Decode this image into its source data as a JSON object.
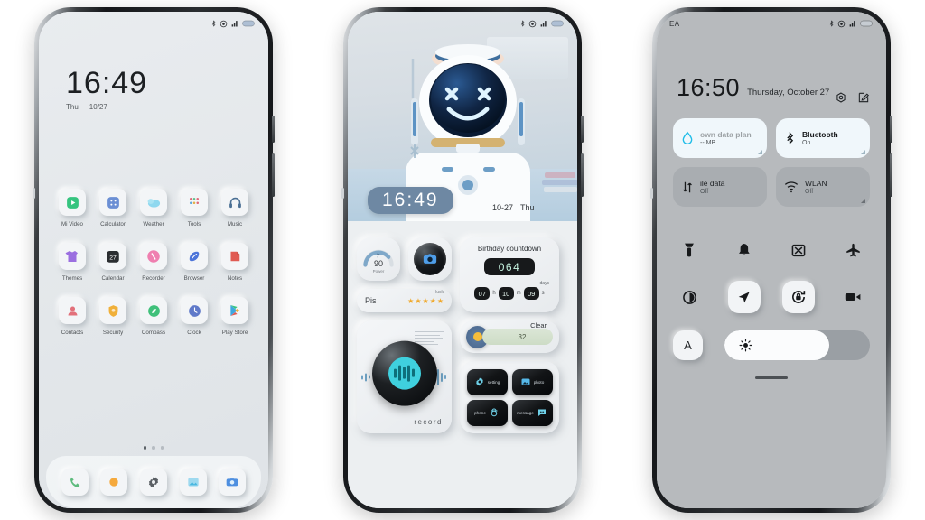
{
  "phone1": {
    "status": {
      "left": "",
      "icons": [
        "bluetooth-icon",
        "dnd-icon",
        "signal-icon",
        "battery-icon"
      ]
    },
    "clock": {
      "time": "16:49",
      "weekday": "Thu",
      "date": "10/27"
    },
    "apps": [
      [
        {
          "label": "Mi Video",
          "icon": "mi-video-icon",
          "color": "#35c47f"
        },
        {
          "label": "Calculator",
          "icon": "calculator-icon",
          "color": "#6b8fd4"
        },
        {
          "label": "Weather",
          "icon": "weather-icon",
          "color": "#4fc3e8"
        },
        {
          "label": "Tools",
          "icon": "tools-icon",
          "color": "#e06a7a"
        },
        {
          "label": "Music",
          "icon": "music-icon",
          "color": "#4a6f94"
        }
      ],
      [
        {
          "label": "Themes",
          "icon": "themes-icon",
          "color": "#9b6fe0"
        },
        {
          "label": "Calendar",
          "icon": "calendar-icon",
          "color": "#2b2e31"
        },
        {
          "label": "Recorder",
          "icon": "recorder-icon",
          "color": "#ef7fb0"
        },
        {
          "label": "Browser",
          "icon": "browser-icon",
          "color": "#4c74d9"
        },
        {
          "label": "Notes",
          "icon": "notes-icon",
          "color": "#e05a52"
        }
      ],
      [
        {
          "label": "Contacts",
          "icon": "contacts-icon",
          "color": "#e2707a"
        },
        {
          "label": "Security",
          "icon": "security-icon",
          "color": "#f0b03a"
        },
        {
          "label": "Compass",
          "icon": "compass-icon",
          "color": "#3fc07a"
        },
        {
          "label": "Clock",
          "icon": "clock-icon",
          "color": "#5f79c9"
        },
        {
          "label": "Play Store",
          "icon": "play-store-icon",
          "color": "#3ea7e0"
        }
      ]
    ],
    "calendar_day": "27",
    "page_dots": {
      "count": 3,
      "active_index": 0
    },
    "dock": [
      {
        "label": "Phone",
        "icon": "phone-icon",
        "color": "#5dbb7d"
      },
      {
        "label": "Browser",
        "icon": "orange-dot-icon",
        "color": "#f5a93c"
      },
      {
        "label": "Settings",
        "icon": "gear-icon",
        "color": "#5a5f64"
      },
      {
        "label": "Gallery",
        "icon": "gallery-icon",
        "color": "#49b8e0"
      },
      {
        "label": "Camera",
        "icon": "camera-icon",
        "color": "#4e8fe0"
      }
    ]
  },
  "phone2": {
    "status": {
      "icons": [
        "bluetooth-icon",
        "dnd-icon",
        "signal-icon",
        "battery-icon"
      ]
    },
    "wallpaper": {
      "name": "astronaut-mascot-wallpaper"
    },
    "clock": {
      "time": "16:49",
      "date": "10-27",
      "weekday": "Thu"
    },
    "power_widget": {
      "value": "90",
      "label": "Power",
      "icon": "bolt-icon"
    },
    "camera_widget": {
      "icon": "camera-icon"
    },
    "pis_widget": {
      "name": "Pis",
      "luck_label": "luck",
      "stars": 5,
      "star_glyph": "★"
    },
    "birthday_widget": {
      "title": "Birthday countdown",
      "days": "064",
      "days_label": "days",
      "hours": "07",
      "hours_unit": "h",
      "minutes": "10",
      "minutes_unit": "m",
      "seconds": "09",
      "seconds_unit": "s"
    },
    "record_widget": {
      "label": "record",
      "icon": "audio-wave-icon"
    },
    "weather_widget": {
      "condition": "Clear",
      "temperature": "32",
      "icon": "sun-icon"
    },
    "quad_widget": [
      {
        "label": "setting",
        "icon": "gear-icon"
      },
      {
        "label": "photo",
        "icon": "photo-icon"
      },
      {
        "label": "phone",
        "icon": "phone-icon"
      },
      {
        "label": "message",
        "icon": "message-icon"
      }
    ]
  },
  "phone3": {
    "status": {
      "left": "EA",
      "icons": [
        "bluetooth-icon",
        "dnd-icon",
        "signal-icon",
        "battery-icon"
      ]
    },
    "clock": {
      "time": "16:50",
      "date": "Thursday, October 27"
    },
    "header_icons": [
      {
        "name": "settings-gear-icon"
      },
      {
        "name": "edit-icon"
      }
    ],
    "tiles": [
      {
        "name": "data-plan-tile",
        "title": "own data plan",
        "subtitle": "-- MB",
        "icon": "data-drop-icon",
        "state": "on"
      },
      {
        "name": "bluetooth-tile",
        "title": "Bluetooth",
        "subtitle": "On",
        "icon": "bluetooth-icon",
        "state": "on"
      },
      {
        "name": "mobile-data-tile",
        "title": "ile data",
        "subtitle": "Off",
        "icon": "mobile-data-icon",
        "state": "off"
      },
      {
        "name": "wlan-tile",
        "title": "WLAN",
        "subtitle": "Off",
        "icon": "wifi-icon",
        "state": "off"
      }
    ],
    "icon_row_1": [
      {
        "name": "flashlight-icon",
        "raised": false
      },
      {
        "name": "bell-icon",
        "raised": false
      },
      {
        "name": "screenshot-icon",
        "raised": false
      },
      {
        "name": "airplane-icon",
        "raised": false
      }
    ],
    "icon_row_2": [
      {
        "name": "dark-mode-icon",
        "raised": false
      },
      {
        "name": "location-icon",
        "raised": true
      },
      {
        "name": "rotation-lock-icon",
        "raised": true
      },
      {
        "name": "screen-record-icon",
        "raised": false
      }
    ],
    "brightness": {
      "icon": "sun-icon",
      "value_percent": 72,
      "auto_label": "A"
    },
    "home_handle": "home-indicator"
  },
  "colors": {
    "page_background": "#ffffff",
    "phone1_screen": "#e6e9ec",
    "phone2_screen": "#eceff1",
    "phone3_screen": "#b7babd",
    "accent_clock_pill": "#6e88a3",
    "accent_record": "#3fd0de",
    "accent_star": "#f0a92c"
  }
}
